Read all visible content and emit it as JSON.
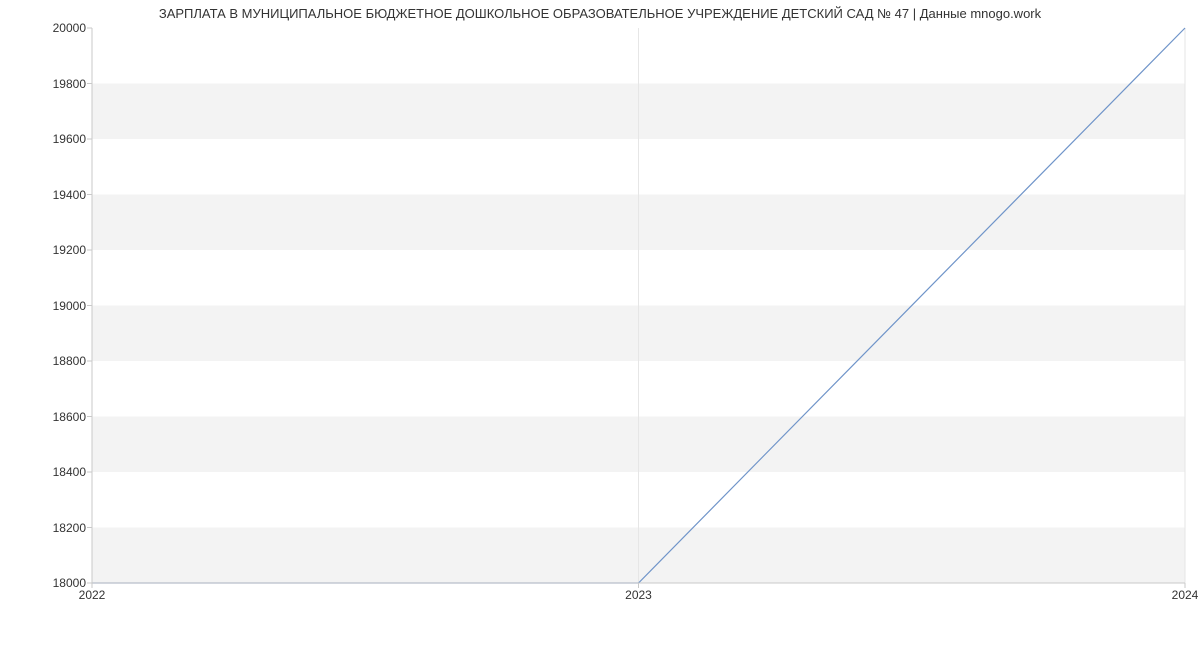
{
  "chart_data": {
    "type": "line",
    "title": "ЗАРПЛАТА В МУНИЦИПАЛЬНОЕ БЮДЖЕТНОЕ ДОШКОЛЬНОЕ ОБРАЗОВАТЕЛЬНОЕ УЧРЕЖДЕНИЕ ДЕТСКИЙ САД № 47 | Данные mnogo.work",
    "x": [
      2022,
      2023,
      2024
    ],
    "values": [
      18000,
      18000,
      20000
    ],
    "x_tick_labels": [
      "2022",
      "2023",
      "2024"
    ],
    "y_ticks": [
      18000,
      18200,
      18400,
      18600,
      18800,
      19000,
      19200,
      19400,
      19600,
      19800,
      20000
    ],
    "y_tick_labels": [
      "18000",
      "18200",
      "18400",
      "18600",
      "18800",
      "19000",
      "19200",
      "19400",
      "19600",
      "19800",
      "20000"
    ],
    "xlim": [
      2022,
      2024
    ],
    "ylim": [
      18000,
      20000
    ],
    "xlabel": "",
    "ylabel": "",
    "grid": true,
    "line_color": "#6f94c9",
    "band_color": "#f3f3f3"
  }
}
